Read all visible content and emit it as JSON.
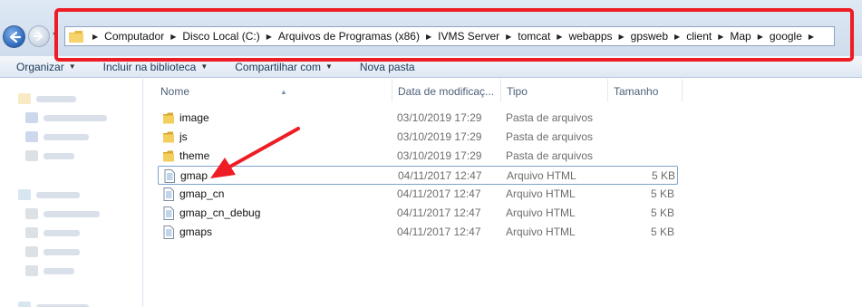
{
  "address_bar": {
    "crumbs": [
      "Computador",
      "Disco Local (C:)",
      "Arquivos de Programas (x86)",
      "IVMS Server",
      "tomcat",
      "webapps",
      "gpsweb",
      "client",
      "Map",
      "google"
    ]
  },
  "toolbar": {
    "organize_label": "Organizar",
    "include_library_label": "Incluir na biblioteca",
    "share_label": "Compartilhar com",
    "new_folder_label": "Nova pasta"
  },
  "columns": {
    "name": "Nome",
    "date": "Data de modificaç...",
    "type": "Tipo",
    "size": "Tamanho"
  },
  "files": [
    {
      "name": "image",
      "date": "03/10/2019 17:29",
      "type": "Pasta de arquivos",
      "size": "",
      "icon": "folder-icon"
    },
    {
      "name": "js",
      "date": "03/10/2019 17:29",
      "type": "Pasta de arquivos",
      "size": "",
      "icon": "folder-icon"
    },
    {
      "name": "theme",
      "date": "03/10/2019 17:29",
      "type": "Pasta de arquivos",
      "size": "",
      "icon": "folder-icon"
    },
    {
      "name": "gmap",
      "date": "04/11/2017 12:47",
      "type": "Arquivo HTML",
      "size": "5 KB",
      "icon": "html-file-icon"
    },
    {
      "name": "gmap_cn",
      "date": "04/11/2017 12:47",
      "type": "Arquivo HTML",
      "size": "5 KB",
      "icon": "html-file-icon"
    },
    {
      "name": "gmap_cn_debug",
      "date": "04/11/2017 12:47",
      "type": "Arquivo HTML",
      "size": "5 KB",
      "icon": "html-file-icon"
    },
    {
      "name": "gmaps",
      "date": "04/11/2017 12:47",
      "type": "Arquivo HTML",
      "size": "5 KB",
      "icon": "html-file-icon"
    }
  ],
  "selected_file": "gmap",
  "colors": {
    "annotation_red": "#ee1c24",
    "selection_border": "#7da2ce",
    "folder_yellow": "#f0c84a"
  }
}
